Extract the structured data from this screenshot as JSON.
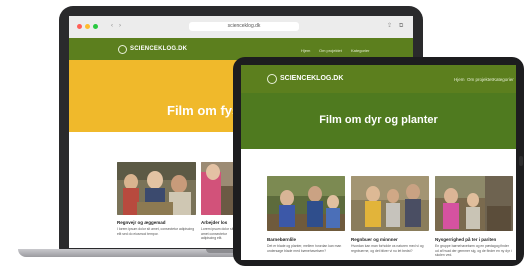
{
  "laptop": {
    "browser": {
      "address": "scienceklog.dk",
      "dot_colors": [
        "#ff5f57",
        "#febc2e",
        "#28c840"
      ]
    },
    "site": {
      "logo_text": "SCIENCEKLOG.DK",
      "nav_items": [
        "Hjem",
        "Om projektet",
        "Kategorier"
      ],
      "hero_title": "Film om fysisk,",
      "hero_color": "#f0b92b",
      "header_color": "#5c7f1e",
      "cards": [
        {
          "title": "Regnvejr og æggemad",
          "text": "I lorem ipsum dolor sit amet, consectetur adipiscing elit sed do eiusmod tempor."
        },
        {
          "title": "Arbejder los",
          "text": "Lorem ipsum dolor sit amet consectetur adipiscing elit."
        }
      ]
    }
  },
  "tablet": {
    "site": {
      "logo_text": "SCIENCEKLOG.DK",
      "nav_items": [
        "Hjem",
        "Om projektet",
        "Kategorier"
      ],
      "hero_title": "Film om dyr og planter",
      "header_color": "#5c7f1e",
      "hero_color": "#4f7a1f",
      "cards": [
        {
          "title": "Barnebørnlile",
          "text": "Det er blade og planter, mellem hvordan kan man undersøge blade med børnehavebørn?"
        },
        {
          "title": "Regnbuer og minnner",
          "text": "Hvordan kan man forholde os naturen med vi og regnbuerne, og det bliver vi nu let bedst?"
        },
        {
          "title": "Nysgerrighed på ter i pariten",
          "text": "En gruppe børnehavebørn og en pædagog finder ud af hvad der gemmer sig, og de finder en ny dyr i skolen ved."
        }
      ]
    }
  }
}
